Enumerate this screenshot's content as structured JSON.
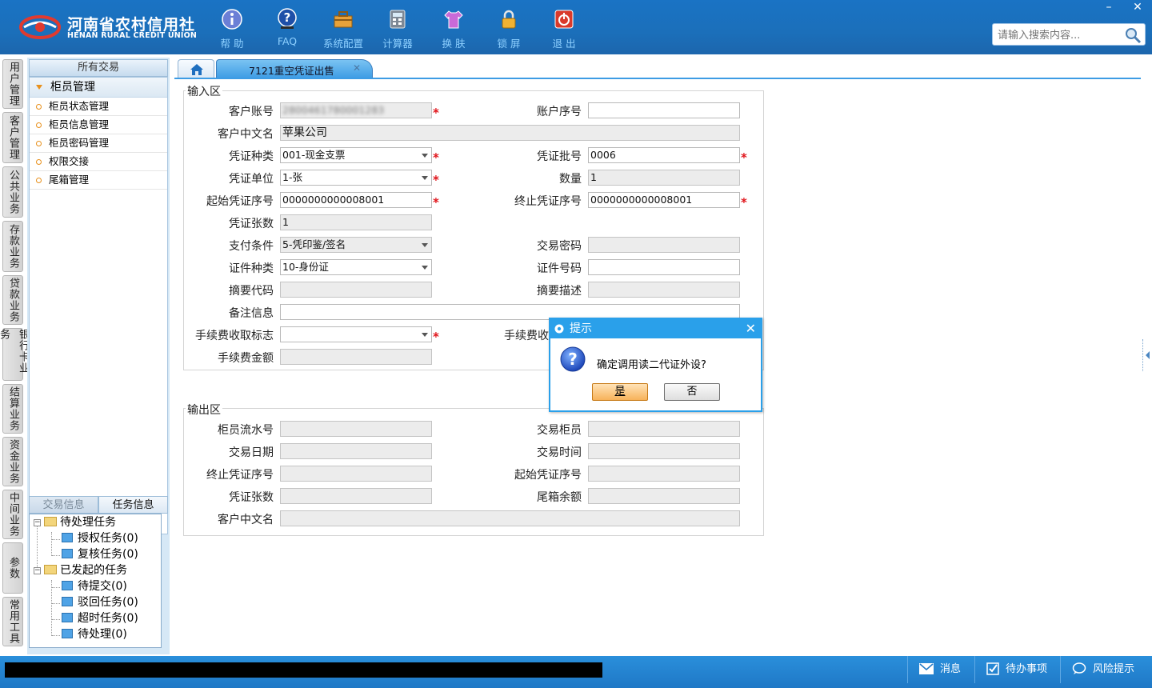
{
  "app": {
    "logo_cn": "河南省农村信用社",
    "logo_en": "HENAN RURAL CREDIT UNION",
    "toolbar": [
      {
        "label": "帮 助",
        "icon": "info-icon"
      },
      {
        "label": "FAQ",
        "icon": "faq-icon"
      },
      {
        "label": "系统配置",
        "icon": "toolbox-icon"
      },
      {
        "label": "计算器",
        "icon": "calculator-icon"
      },
      {
        "label": "换 肤",
        "icon": "shirt-icon"
      },
      {
        "label": "锁 屏",
        "icon": "lock-icon"
      },
      {
        "label": "退 出",
        "icon": "power-icon"
      }
    ],
    "window_controls": {
      "minimize": "–",
      "close": "✕"
    },
    "search_placeholder": "请输入搜索内容..."
  },
  "vtabs": [
    "用户管理",
    "客户管理",
    "公共业务",
    "存款业务",
    "贷款业务",
    "银行卡业务",
    "结算业务",
    "资金业务",
    "中间业务",
    "参数",
    "常用工具"
  ],
  "left_menu": {
    "header": "所有交易",
    "group": "柜员管理",
    "items": [
      "柜员状态管理",
      "柜员信息管理",
      "柜员密码管理",
      "权限交接",
      "尾箱管理"
    ]
  },
  "task_panel": {
    "tabs": [
      "交易信息",
      "任务信息"
    ],
    "tree": [
      {
        "label": "待处理任务",
        "children": [
          "授权任务(0)",
          "复核任务(0)"
        ]
      },
      {
        "label": "已发起的任务",
        "children": [
          "待提交(0)",
          "驳回任务(0)",
          "超时任务(0)",
          "待处理(0)"
        ]
      }
    ]
  },
  "tabs": {
    "active": "7121重空凭证出售",
    "close": "✕"
  },
  "input_section": {
    "title": "输入区",
    "labels": {
      "cust_account": "客户账号",
      "account_seq": "账户序号",
      "cust_name": "客户中文名",
      "voucher_type": "凭证种类",
      "voucher_batch": "凭证批号",
      "voucher_unit": "凭证单位",
      "quantity": "数量",
      "start_seq": "起始凭证序号",
      "end_seq": "终止凭证序号",
      "voucher_count": "凭证张数",
      "pay_cond": "支付条件",
      "trade_pwd": "交易密码",
      "id_type": "证件种类",
      "id_no": "证件号码",
      "summary_code": "摘要代码",
      "summary_desc": "摘要描述",
      "remark": "备注信息",
      "fee_flag": "手续费收取标志",
      "fee_right": "手续费收",
      "fee_amount": "手续费金额"
    },
    "values": {
      "cust_account": "2800461780001283",
      "account_seq": "",
      "cust_name": "苹果公司",
      "voucher_type": "001-现金支票",
      "voucher_batch": "0006",
      "voucher_unit": "1-张",
      "quantity": "1",
      "start_seq": "0000000000008001",
      "end_seq": "0000000000008001",
      "voucher_count": "1",
      "pay_cond": "5-凭印鉴/签名",
      "trade_pwd": "",
      "id_type": "10-身份证",
      "id_no": "",
      "summary_code": "",
      "summary_desc": "",
      "remark": "",
      "fee_flag": "",
      "fee_amount": ""
    },
    "required_mark": "*"
  },
  "output_section": {
    "title": "输出区",
    "labels": {
      "teller_serial": "柜员流水号",
      "trade_teller": "交易柜员",
      "trade_date": "交易日期",
      "trade_time": "交易时间",
      "end_seq": "终止凭证序号",
      "start_seq": "起始凭证序号",
      "voucher_count": "凭证张数",
      "box_balance": "尾箱余额",
      "cust_name": "客户中文名"
    }
  },
  "dialog": {
    "title": "提示",
    "close": "✕",
    "message": "确定调用读二代证外设?",
    "yes": "是",
    "no": "否"
  },
  "statusbar": {
    "message": "消息",
    "todo": "待办事项",
    "risk": "风险提示"
  },
  "colors": {
    "header_blue": "#1b6fba",
    "accent_blue": "#2aa0ea",
    "required_red": "#e0141a"
  }
}
